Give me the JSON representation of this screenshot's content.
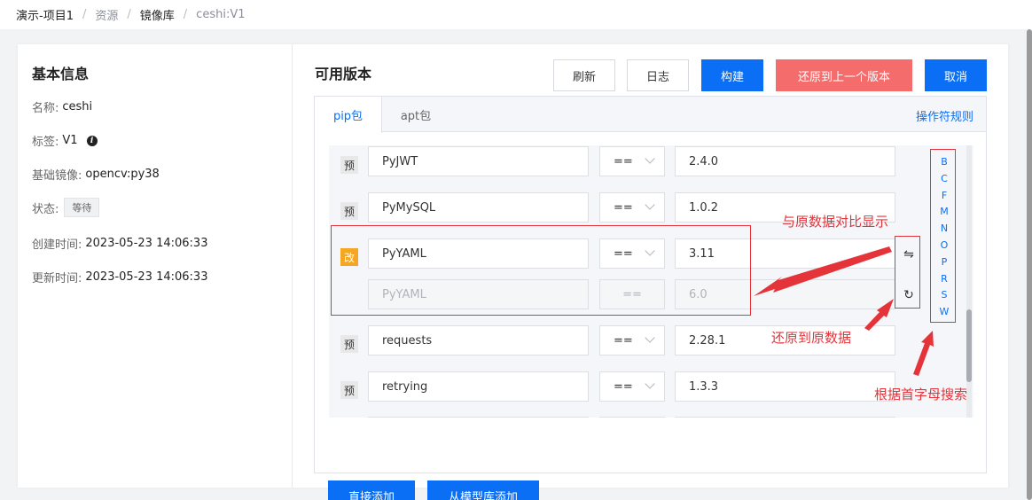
{
  "breadcrumb": [
    "演示-项目1",
    "资源",
    "镜像库",
    "ceshi:V1"
  ],
  "basic_info": {
    "title": "基本信息",
    "name_label": "名称:",
    "name_value": "ceshi",
    "tag_label": "标签:",
    "tag_value": "V1",
    "info_icon": "info-icon",
    "base_label": "基础镜像:",
    "base_value": "opencv:py38",
    "status_label": "状态:",
    "status_value": "等待",
    "created_label": "创建时间:",
    "created_value": "2023-05-23 14:06:33",
    "updated_label": "更新时间:",
    "updated_value": "2023-05-23 14:06:33"
  },
  "versions": {
    "title": "可用版本",
    "buttons": {
      "refresh": "刷新",
      "log": "日志",
      "build": "构建",
      "restore_prev": "还原到上一个版本",
      "cancel": "取消"
    },
    "tabs": {
      "pip": "pip包",
      "apt": "apt包",
      "rules": "操作符规则"
    },
    "packages": [
      {
        "tag": "预",
        "name": "PyJWT",
        "op": "==",
        "version": "2.4.0"
      },
      {
        "tag": "预",
        "name": "PyMySQL",
        "op": "==",
        "version": "1.0.2"
      },
      {
        "tag": "改",
        "name": "PyYAML",
        "op": "==",
        "version": "3.11",
        "orig_name": "PyYAML",
        "orig_op": "==",
        "orig_version": "6.0"
      },
      {
        "tag": "预",
        "name": "requests",
        "op": "==",
        "version": "2.28.1"
      },
      {
        "tag": "预",
        "name": "retrying",
        "op": "==",
        "version": "1.3.3"
      }
    ],
    "compare_icon": "⇋",
    "restore_icon": "↻",
    "letters": [
      "B",
      "C",
      "F",
      "M",
      "N",
      "O",
      "P",
      "R",
      "S",
      "W"
    ],
    "add_direct": "直接添加",
    "add_from_repo": "从模型库添加"
  },
  "annotations": {
    "compare": "与原数据对比显示",
    "restore": "还原到原数据",
    "letter_search": "根据首字母搜索"
  },
  "colors": {
    "primary": "#0a6ff5",
    "danger": "#f56c6c",
    "annotation": "#e5333a",
    "modified_tag": "#f5a623"
  }
}
